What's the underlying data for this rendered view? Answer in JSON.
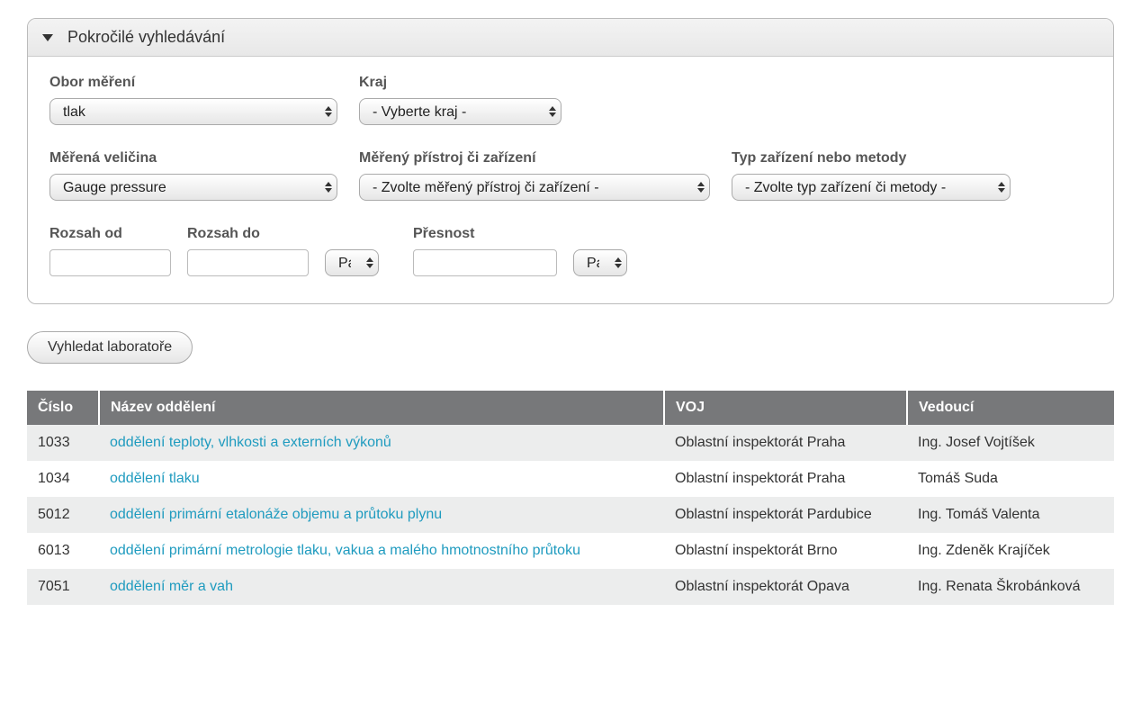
{
  "panel": {
    "title": "Pokročilé vyhledávání",
    "labels": {
      "obor": "Obor měření",
      "kraj": "Kraj",
      "velicina": "Měřená veličina",
      "pristroj": "Měřený přístroj či zařízení",
      "typ": "Typ zařízení nebo metody",
      "rozsah_od": "Rozsah od",
      "rozsah_do": "Rozsah do",
      "presnost": "Přesnost"
    },
    "selects": {
      "obor": {
        "value": "tlak"
      },
      "kraj": {
        "value": "- Vyberte kraj -"
      },
      "velicina": {
        "value": "Gauge pressure"
      },
      "pristroj": {
        "value": "- Zvolte měřený přístroj či zařízení -"
      },
      "typ": {
        "value": "- Zvolte typ zařízení či metody -"
      },
      "unit_rozsah": {
        "value": "Pa"
      },
      "unit_presnost": {
        "value": "Pa"
      }
    },
    "inputs": {
      "rozsah_od": "",
      "rozsah_do": "",
      "presnost": ""
    }
  },
  "search_button": "Vyhledat laboratoře",
  "table": {
    "headers": {
      "cislo": "Číslo",
      "nazev": "Název oddělení",
      "voj": "VOJ",
      "vedouci": "Vedoucí"
    },
    "rows": [
      {
        "cislo": "1033",
        "nazev": "oddělení teploty, vlhkosti a externích výkonů",
        "voj": "Oblastní inspektorát Praha",
        "vedouci": "Ing. Josef Vojtíšek"
      },
      {
        "cislo": "1034",
        "nazev": "oddělení tlaku",
        "voj": "Oblastní inspektorát Praha",
        "vedouci": "Tomáš Suda"
      },
      {
        "cislo": "5012",
        "nazev": "oddělení primární etalonáže objemu a průtoku plynu",
        "voj": "Oblastní inspektorát Pardubice",
        "vedouci": "Ing. Tomáš Valenta"
      },
      {
        "cislo": "6013",
        "nazev": "oddělení primární metrologie tlaku, vakua a malého hmotnostního průtoku",
        "voj": "Oblastní inspektorát Brno",
        "vedouci": "Ing. Zdeněk Krajíček"
      },
      {
        "cislo": "7051",
        "nazev": "oddělení měr a vah",
        "voj": "Oblastní inspektorát Opava",
        "vedouci": "Ing. Renata Škrobánková"
      }
    ]
  }
}
